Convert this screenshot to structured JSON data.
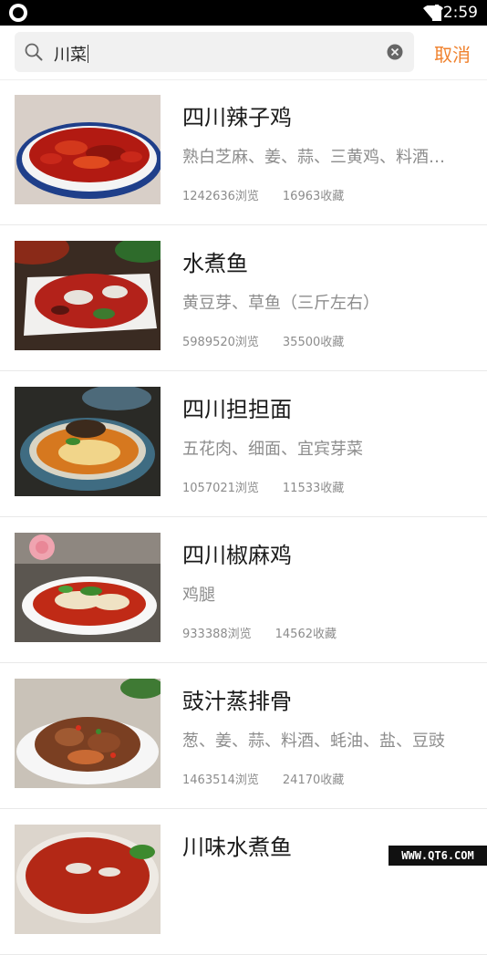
{
  "status_bar": {
    "time": "2:59"
  },
  "search": {
    "query": "川菜",
    "cancel_label": "取消"
  },
  "recipes": [
    {
      "title": "四川辣子鸡",
      "ingredients": "熟白芝麻、姜、蒜、三黄鸡、料酒、盐、干辣椒",
      "views": "1242636浏览",
      "favorites": "16963收藏"
    },
    {
      "title": "水煮鱼",
      "ingredients": "黄豆芽、草鱼（三斤左右）",
      "views": "5989520浏览",
      "favorites": "35500收藏"
    },
    {
      "title": "四川担担面",
      "ingredients": "五花肉、细面、宜宾芽菜",
      "views": "1057021浏览",
      "favorites": "11533收藏"
    },
    {
      "title": "四川椒麻鸡",
      "ingredients": "鸡腿",
      "views": "933388浏览",
      "favorites": "14562收藏"
    },
    {
      "title": "豉汁蒸排骨",
      "ingredients": "葱、姜、蒜、料酒、蚝油、盐、豆豉",
      "views": "1463514浏览",
      "favorites": "24170收藏"
    },
    {
      "title": "川味水煮鱼",
      "ingredients": "",
      "views": "",
      "favorites": ""
    }
  ],
  "watermark": "WWW.QT6.COM"
}
